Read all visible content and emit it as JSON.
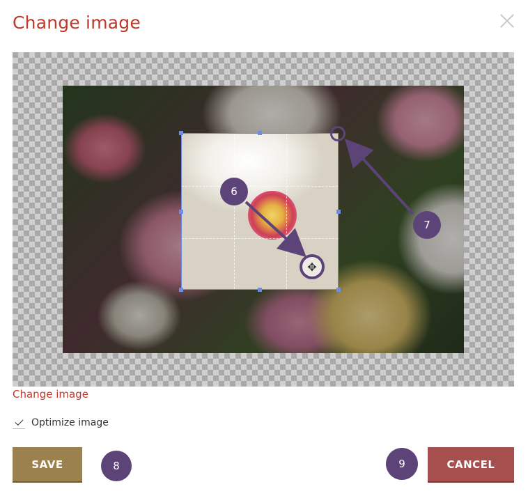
{
  "dialog": {
    "title": "Change image",
    "close_icon": "close-icon"
  },
  "editor": {
    "callouts": [
      "6",
      "7"
    ],
    "move_icon": "move-icon"
  },
  "change_link": "Change image",
  "optimize": {
    "label": "Optimize image",
    "checked": true
  },
  "buttons": {
    "save": "SAVE",
    "cancel": "CANCEL"
  },
  "footer_callouts": [
    "8",
    "9"
  ],
  "colors": {
    "accent_red": "#c0392b",
    "save_button": "#9b814e",
    "cancel_button": "#a54f4f",
    "callout": "#5c4479",
    "crop_border": "#6f8de8"
  }
}
